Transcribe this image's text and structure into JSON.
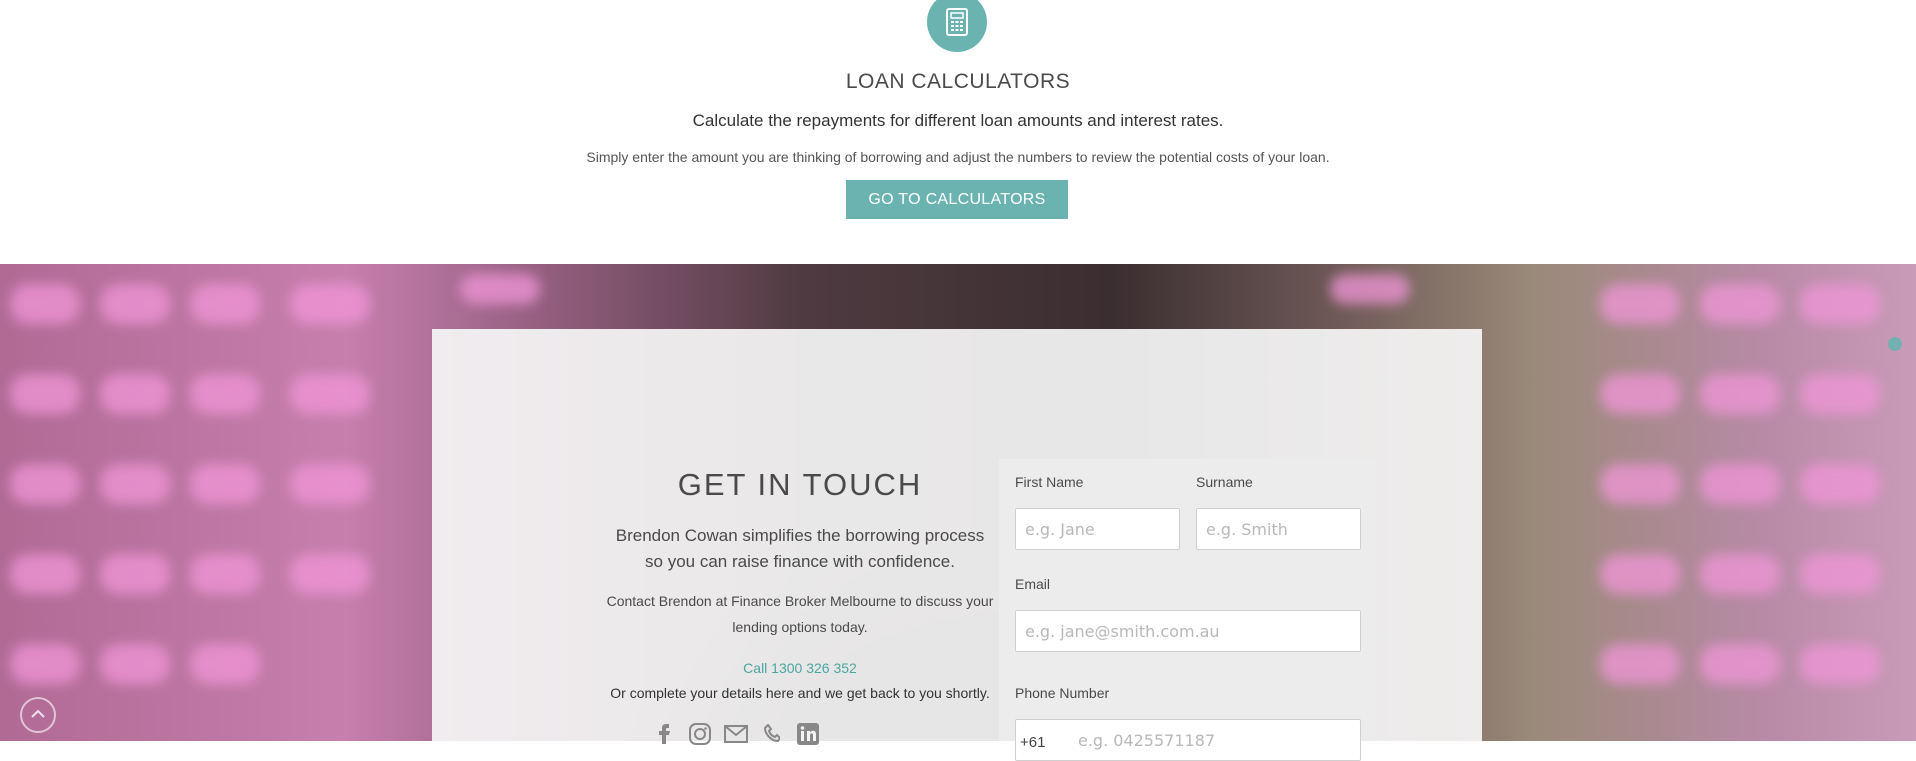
{
  "calculators": {
    "icon": "calculator-icon",
    "title": "LOAN CALCULATORS",
    "subtitle": "Calculate the repayments for different loan amounts and interest rates.",
    "description": "Simply enter the amount you are thinking of borrowing and adjust the numbers to review the potential costs of your loan.",
    "button_label": "GO TO CALCULATORS"
  },
  "contact": {
    "title": "GET IN TOUCH",
    "lead_line1": "Brendon Cowan simplifies the borrowing process",
    "lead_line2": "so you can raise finance with confidence.",
    "contact_line1": "Contact Brendon at Finance Broker Melbourne to discuss your",
    "contact_line2": "lending options today.",
    "call_link": "Call 1300 326 352",
    "complete_text": "Or complete your details here and we get back to you shortly.",
    "social_icons": [
      "facebook-icon",
      "instagram-icon",
      "email-icon",
      "phone-icon",
      "linkedin-icon"
    ]
  },
  "form": {
    "first_name_label": "First Name",
    "first_name_placeholder": "e.g. Jane",
    "surname_label": "Surname",
    "surname_placeholder": "e.g. Smith",
    "email_label": "Email",
    "email_placeholder": "e.g. jane@smith.com.au",
    "phone_label": "Phone Number",
    "phone_prefix": "+61",
    "phone_placeholder": "e.g. 0425571187"
  },
  "colors": {
    "accent": "#6ab3b0",
    "link": "#4aa6a2",
    "text": "#4a4a4a"
  },
  "controls": {
    "scroll_top_icon": "chevron-up-icon"
  }
}
